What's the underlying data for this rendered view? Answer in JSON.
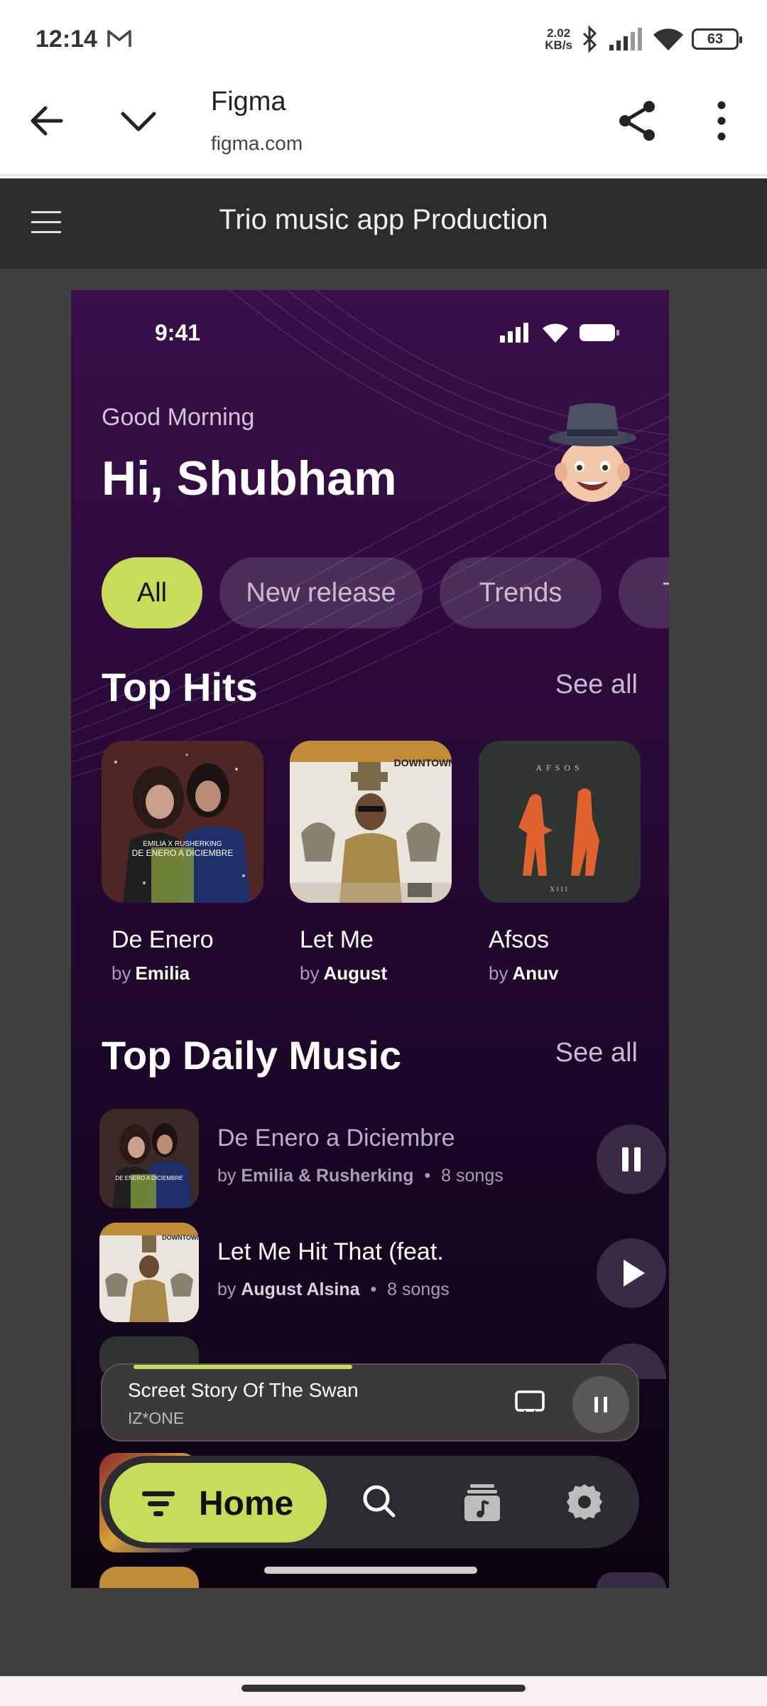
{
  "status_bar": {
    "time": "12:14",
    "speed_value": "2.02",
    "speed_unit": "KB/s",
    "battery": "63"
  },
  "browser": {
    "title": "Figma",
    "url": "figma.com"
  },
  "figma": {
    "file_title": "Trio music app Production"
  },
  "app": {
    "phone_time": "9:41",
    "greeting_small": "Good Morning",
    "greeting_big": "Hi, Shubham",
    "chips": [
      "All",
      "New release",
      "Trends",
      "T"
    ],
    "top_hits": {
      "title": "Top Hits",
      "see_all": "See all",
      "items": [
        {
          "title": "De Enero",
          "by": "by",
          "artist": "Emilia"
        },
        {
          "title": "Let Me",
          "by": "by",
          "artist": "August"
        },
        {
          "title": "Afsos",
          "by": "by",
          "artist": "Anuv"
        }
      ]
    },
    "top_daily": {
      "title": "Top Daily Music",
      "see_all": "See all",
      "items": [
        {
          "title": "De Enero  a Diciembre",
          "by": "by",
          "artist": "Emilia & Rusherking",
          "sep": "•",
          "count": "8 songs",
          "state": "pause"
        },
        {
          "title": "Let Me Hit That (feat.",
          "by": "by",
          "artist": "August Alsina",
          "sep": "•",
          "count": "8 songs",
          "state": "play"
        }
      ]
    },
    "mini_player": {
      "title": "Screet Story Of The Swan",
      "artist": "IZ*ONE",
      "progress": 0.46
    },
    "nav": {
      "home_label": "Home",
      "icons": [
        "search-icon",
        "library-icon",
        "settings-icon"
      ]
    }
  },
  "colors": {
    "accent": "#c8dc5a",
    "phone_bg_top": "#3a0f4a",
    "phone_bg_bottom": "#0c0412",
    "figma_header": "#2c2c2c",
    "canvas": "#404040"
  }
}
